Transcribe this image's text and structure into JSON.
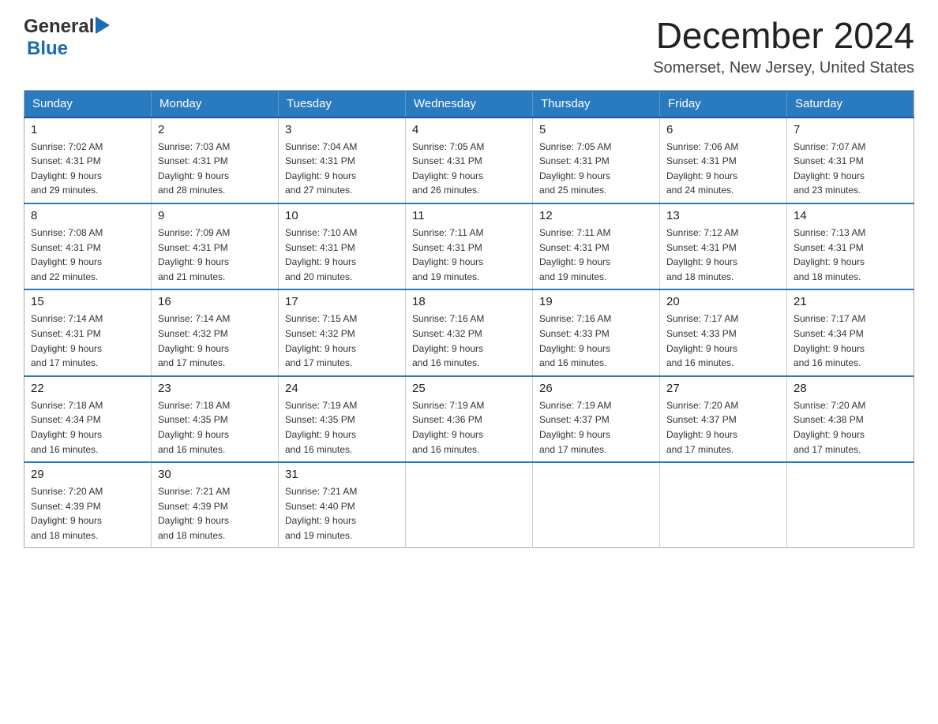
{
  "logo": {
    "general": "General",
    "blue": "Blue"
  },
  "header": {
    "month": "December 2024",
    "location": "Somerset, New Jersey, United States"
  },
  "weekdays": [
    "Sunday",
    "Monday",
    "Tuesday",
    "Wednesday",
    "Thursday",
    "Friday",
    "Saturday"
  ],
  "weeks": [
    [
      {
        "day": "1",
        "sunrise": "Sunrise: 7:02 AM",
        "sunset": "Sunset: 4:31 PM",
        "daylight": "Daylight: 9 hours",
        "daylight2": "and 29 minutes."
      },
      {
        "day": "2",
        "sunrise": "Sunrise: 7:03 AM",
        "sunset": "Sunset: 4:31 PM",
        "daylight": "Daylight: 9 hours",
        "daylight2": "and 28 minutes."
      },
      {
        "day": "3",
        "sunrise": "Sunrise: 7:04 AM",
        "sunset": "Sunset: 4:31 PM",
        "daylight": "Daylight: 9 hours",
        "daylight2": "and 27 minutes."
      },
      {
        "day": "4",
        "sunrise": "Sunrise: 7:05 AM",
        "sunset": "Sunset: 4:31 PM",
        "daylight": "Daylight: 9 hours",
        "daylight2": "and 26 minutes."
      },
      {
        "day": "5",
        "sunrise": "Sunrise: 7:05 AM",
        "sunset": "Sunset: 4:31 PM",
        "daylight": "Daylight: 9 hours",
        "daylight2": "and 25 minutes."
      },
      {
        "day": "6",
        "sunrise": "Sunrise: 7:06 AM",
        "sunset": "Sunset: 4:31 PM",
        "daylight": "Daylight: 9 hours",
        "daylight2": "and 24 minutes."
      },
      {
        "day": "7",
        "sunrise": "Sunrise: 7:07 AM",
        "sunset": "Sunset: 4:31 PM",
        "daylight": "Daylight: 9 hours",
        "daylight2": "and 23 minutes."
      }
    ],
    [
      {
        "day": "8",
        "sunrise": "Sunrise: 7:08 AM",
        "sunset": "Sunset: 4:31 PM",
        "daylight": "Daylight: 9 hours",
        "daylight2": "and 22 minutes."
      },
      {
        "day": "9",
        "sunrise": "Sunrise: 7:09 AM",
        "sunset": "Sunset: 4:31 PM",
        "daylight": "Daylight: 9 hours",
        "daylight2": "and 21 minutes."
      },
      {
        "day": "10",
        "sunrise": "Sunrise: 7:10 AM",
        "sunset": "Sunset: 4:31 PM",
        "daylight": "Daylight: 9 hours",
        "daylight2": "and 20 minutes."
      },
      {
        "day": "11",
        "sunrise": "Sunrise: 7:11 AM",
        "sunset": "Sunset: 4:31 PM",
        "daylight": "Daylight: 9 hours",
        "daylight2": "and 19 minutes."
      },
      {
        "day": "12",
        "sunrise": "Sunrise: 7:11 AM",
        "sunset": "Sunset: 4:31 PM",
        "daylight": "Daylight: 9 hours",
        "daylight2": "and 19 minutes."
      },
      {
        "day": "13",
        "sunrise": "Sunrise: 7:12 AM",
        "sunset": "Sunset: 4:31 PM",
        "daylight": "Daylight: 9 hours",
        "daylight2": "and 18 minutes."
      },
      {
        "day": "14",
        "sunrise": "Sunrise: 7:13 AM",
        "sunset": "Sunset: 4:31 PM",
        "daylight": "Daylight: 9 hours",
        "daylight2": "and 18 minutes."
      }
    ],
    [
      {
        "day": "15",
        "sunrise": "Sunrise: 7:14 AM",
        "sunset": "Sunset: 4:31 PM",
        "daylight": "Daylight: 9 hours",
        "daylight2": "and 17 minutes."
      },
      {
        "day": "16",
        "sunrise": "Sunrise: 7:14 AM",
        "sunset": "Sunset: 4:32 PM",
        "daylight": "Daylight: 9 hours",
        "daylight2": "and 17 minutes."
      },
      {
        "day": "17",
        "sunrise": "Sunrise: 7:15 AM",
        "sunset": "Sunset: 4:32 PM",
        "daylight": "Daylight: 9 hours",
        "daylight2": "and 17 minutes."
      },
      {
        "day": "18",
        "sunrise": "Sunrise: 7:16 AM",
        "sunset": "Sunset: 4:32 PM",
        "daylight": "Daylight: 9 hours",
        "daylight2": "and 16 minutes."
      },
      {
        "day": "19",
        "sunrise": "Sunrise: 7:16 AM",
        "sunset": "Sunset: 4:33 PM",
        "daylight": "Daylight: 9 hours",
        "daylight2": "and 16 minutes."
      },
      {
        "day": "20",
        "sunrise": "Sunrise: 7:17 AM",
        "sunset": "Sunset: 4:33 PM",
        "daylight": "Daylight: 9 hours",
        "daylight2": "and 16 minutes."
      },
      {
        "day": "21",
        "sunrise": "Sunrise: 7:17 AM",
        "sunset": "Sunset: 4:34 PM",
        "daylight": "Daylight: 9 hours",
        "daylight2": "and 16 minutes."
      }
    ],
    [
      {
        "day": "22",
        "sunrise": "Sunrise: 7:18 AM",
        "sunset": "Sunset: 4:34 PM",
        "daylight": "Daylight: 9 hours",
        "daylight2": "and 16 minutes."
      },
      {
        "day": "23",
        "sunrise": "Sunrise: 7:18 AM",
        "sunset": "Sunset: 4:35 PM",
        "daylight": "Daylight: 9 hours",
        "daylight2": "and 16 minutes."
      },
      {
        "day": "24",
        "sunrise": "Sunrise: 7:19 AM",
        "sunset": "Sunset: 4:35 PM",
        "daylight": "Daylight: 9 hours",
        "daylight2": "and 16 minutes."
      },
      {
        "day": "25",
        "sunrise": "Sunrise: 7:19 AM",
        "sunset": "Sunset: 4:36 PM",
        "daylight": "Daylight: 9 hours",
        "daylight2": "and 16 minutes."
      },
      {
        "day": "26",
        "sunrise": "Sunrise: 7:19 AM",
        "sunset": "Sunset: 4:37 PM",
        "daylight": "Daylight: 9 hours",
        "daylight2": "and 17 minutes."
      },
      {
        "day": "27",
        "sunrise": "Sunrise: 7:20 AM",
        "sunset": "Sunset: 4:37 PM",
        "daylight": "Daylight: 9 hours",
        "daylight2": "and 17 minutes."
      },
      {
        "day": "28",
        "sunrise": "Sunrise: 7:20 AM",
        "sunset": "Sunset: 4:38 PM",
        "daylight": "Daylight: 9 hours",
        "daylight2": "and 17 minutes."
      }
    ],
    [
      {
        "day": "29",
        "sunrise": "Sunrise: 7:20 AM",
        "sunset": "Sunset: 4:39 PM",
        "daylight": "Daylight: 9 hours",
        "daylight2": "and 18 minutes."
      },
      {
        "day": "30",
        "sunrise": "Sunrise: 7:21 AM",
        "sunset": "Sunset: 4:39 PM",
        "daylight": "Daylight: 9 hours",
        "daylight2": "and 18 minutes."
      },
      {
        "day": "31",
        "sunrise": "Sunrise: 7:21 AM",
        "sunset": "Sunset: 4:40 PM",
        "daylight": "Daylight: 9 hours",
        "daylight2": "and 19 minutes."
      },
      null,
      null,
      null,
      null
    ]
  ]
}
